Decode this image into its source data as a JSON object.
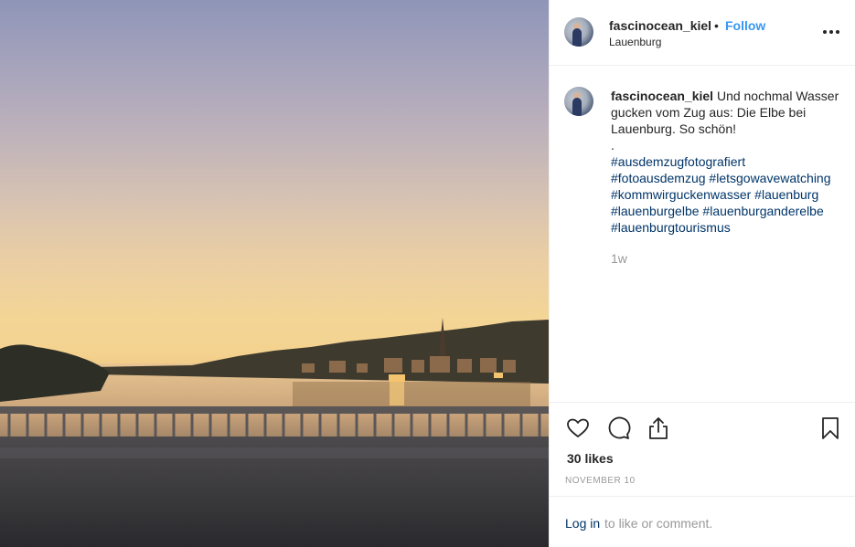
{
  "post": {
    "username": "fascinocean_kiel",
    "separator": "•",
    "follow_label": "Follow",
    "location": "Lauenburg"
  },
  "caption": {
    "username": "fascinocean_kiel",
    "text": " Und nochmal Wasser gucken vom Zug aus: Die Elbe bei Lauenburg. So schön!",
    "dot": ".",
    "hashtags": [
      "#ausdemzugfotografiert",
      "#fotoausdemzug",
      "#letsgowavewatching",
      "#kommwirguckenwasser",
      "#lauenburg",
      "#lauenburgelbe",
      "#lauenburganderelbe",
      "#lauenburgtourismus"
    ],
    "time": "1w"
  },
  "actions": {
    "like_icon": "heart-icon",
    "comment_icon": "comment-icon",
    "share_icon": "share-icon",
    "save_icon": "bookmark-icon",
    "likes_text": "30 likes",
    "date_text": "NOVEMBER 10"
  },
  "login": {
    "link_label": "Log in",
    "rest_text": " to like or comment."
  },
  "colors": {
    "link_blue": "#3897f0",
    "hashtag": "#003569",
    "muted": "#999999"
  }
}
